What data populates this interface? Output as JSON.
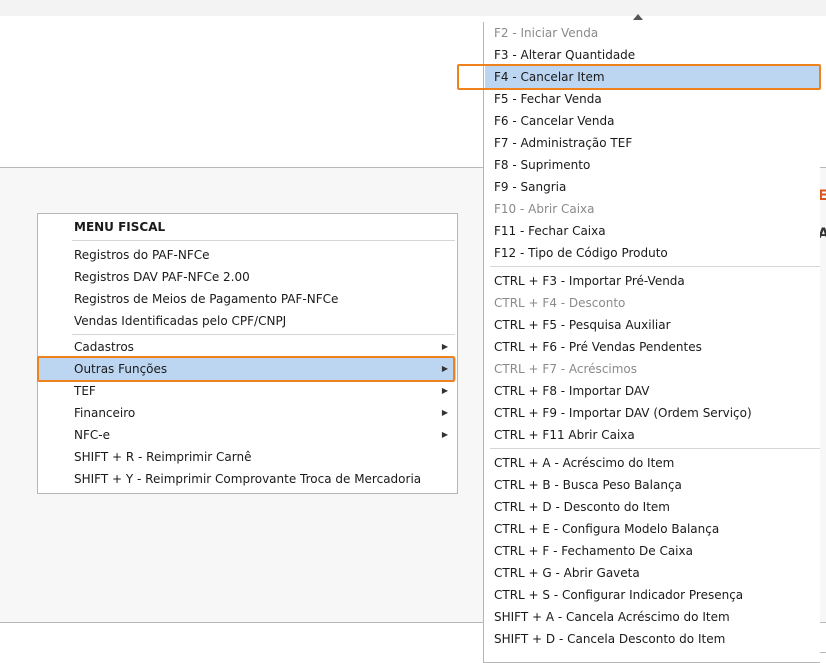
{
  "main_menu": {
    "title": "MENU FISCAL",
    "group1": [
      "Registros do PAF-NFCe",
      "Registros DAV PAF-NFCe 2.00",
      "Registros de Meios de Pagamento PAF-NFCe",
      "Vendas Identificadas pelo CPF/CNPJ"
    ],
    "group2": [
      {
        "label": "Cadastros",
        "submenu": true
      },
      {
        "label": "Outras Funções",
        "submenu": true,
        "selected": true
      },
      {
        "label": "TEF",
        "submenu": true
      },
      {
        "label": "Financeiro",
        "submenu": true
      },
      {
        "label": "NFC-e",
        "submenu": true
      },
      {
        "label": "SHIFT + R - Reimprimir Carnê",
        "submenu": false
      },
      {
        "label": "SHIFT + Y - Reimprimir Comprovante Troca de Mercadoria",
        "submenu": false
      }
    ]
  },
  "sub_menu": {
    "group1": [
      {
        "label": "F2 - Iniciar Venda",
        "disabled": true
      },
      {
        "label": "F3 - Alterar Quantidade",
        "disabled": false
      },
      {
        "label": "F4 - Cancelar Item",
        "disabled": false,
        "selected": true
      },
      {
        "label": "F5 - Fechar Venda",
        "disabled": false
      },
      {
        "label": "F6 - Cancelar Venda",
        "disabled": false
      },
      {
        "label": "F7 - Administração TEF",
        "disabled": false
      },
      {
        "label": "F8 - Suprimento",
        "disabled": false
      },
      {
        "label": "F9 - Sangria",
        "disabled": false
      },
      {
        "label": "F10 - Abrir Caixa",
        "disabled": true
      },
      {
        "label": "F11 - Fechar Caixa",
        "disabled": false
      },
      {
        "label": "F12 - Tipo de Código Produto",
        "disabled": false
      }
    ],
    "group2": [
      {
        "label": "CTRL + F3 - Importar Pré-Venda",
        "disabled": false
      },
      {
        "label": "CTRL + F4 - Desconto",
        "disabled": true
      },
      {
        "label": "CTRL + F5 - Pesquisa Auxiliar",
        "disabled": false
      },
      {
        "label": "CTRL + F6 - Pré Vendas Pendentes",
        "disabled": false
      },
      {
        "label": "CTRL + F7 - Acréscimos",
        "disabled": true
      },
      {
        "label": "CTRL + F8 - Importar DAV",
        "disabled": false
      },
      {
        "label": "CTRL + F9 - Importar DAV (Ordem Serviço)",
        "disabled": false
      },
      {
        "label": "CTRL + F11 Abrir Caixa",
        "disabled": false
      }
    ],
    "group3": [
      {
        "label": "CTRL + A - Acréscimo do Item",
        "disabled": false
      },
      {
        "label": "CTRL + B - Busca Peso Balança",
        "disabled": false
      },
      {
        "label": "CTRL + D - Desconto do Item",
        "disabled": false
      },
      {
        "label": "CTRL + E - Configura Modelo Balança",
        "disabled": false
      },
      {
        "label": "CTRL + F - Fechamento De Caixa",
        "disabled": false
      },
      {
        "label": "CTRL + G - Abrir Gaveta",
        "disabled": false
      },
      {
        "label": "CTRL + S - Configurar Indicador Presença",
        "disabled": false
      },
      {
        "label": "SHIFT + A - Cancela Acréscimo do Item",
        "disabled": false
      },
      {
        "label": "SHIFT + D - Cancela Desconto do Item",
        "disabled": false
      }
    ]
  },
  "side_glyphs": [
    "E",
    "A"
  ],
  "colors": {
    "highlight": "#bcd6f2",
    "focus_outline": "#f0821e",
    "disabled_text": "#8a8a8a"
  }
}
